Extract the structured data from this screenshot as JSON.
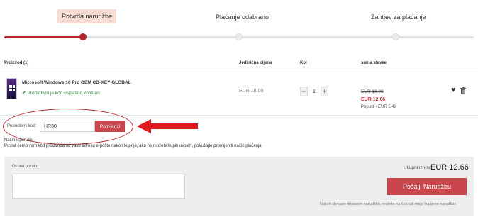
{
  "stepper": {
    "steps": [
      {
        "label": "Potvrda narudžbe",
        "active": true
      },
      {
        "label": "Plaćanje odabrano",
        "active": false
      },
      {
        "label": "Zahtjev za plaćanje",
        "active": false
      }
    ]
  },
  "table": {
    "headers": {
      "product": "Proizvod (1)",
      "unit_price": "Jedinična cijena",
      "qty": "Kol",
      "sum": "suma stavke"
    }
  },
  "product": {
    "name": "Microsoft Windows 10 Pro OEM CD-KEY GLOBAL",
    "promo_status": "Promotivni je kôd uspješno korišten",
    "unit_price": "EUR 18.09",
    "quantity": "1",
    "sum_old": "EUR 18.09",
    "sum_new": "EUR 12.66",
    "discount": "Popust - EUR 5.43"
  },
  "promo": {
    "label": "Promotivni kod:",
    "value": "HR30",
    "apply_label": "Primijeniti"
  },
  "shipping": {
    "title": "Način isporuke:",
    "text": "Poslat ćemo vam kôd proizvoda na vašu adresu e-pošte nakon kupnje, ako ne možete kupiti uspjeh, pokušajte promijeniti način plaćanja"
  },
  "order": {
    "message_label": "Ostavi poruku",
    "total_label": "Ukupni iznos:",
    "total_value": "EUR 12.66",
    "send_label": "Pošalji Narudžbu",
    "footnote": "Nakon što vam dostavim narudžbu, možete na čeknuti moje kupljene narudžbe"
  },
  "icons": {
    "windows": "windows-logo-icon",
    "check": "check-icon",
    "heart": "heart-icon",
    "trash": "trash-icon",
    "arrow": "red-arrow-left-icon"
  },
  "colors": {
    "accent": "#b3272d",
    "button": "#c9474c",
    "success": "#2e8b3c",
    "price_new": "#d0393f",
    "active_step_bg": "#f7dcd3"
  }
}
